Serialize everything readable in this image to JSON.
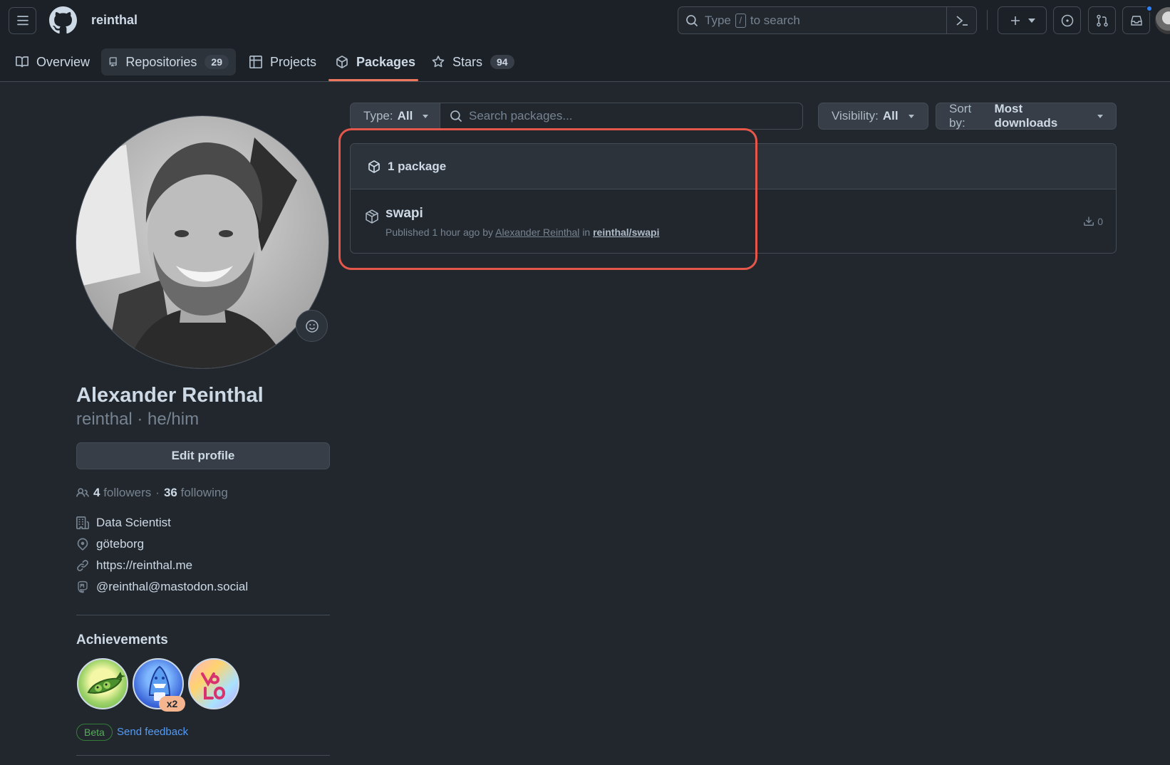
{
  "header": {
    "username": "reinthal",
    "search": {
      "pre": "Type",
      "key": "/",
      "post": "to search"
    }
  },
  "tabs": [
    {
      "label": "Overview"
    },
    {
      "label": "Repositories",
      "count": "29"
    },
    {
      "label": "Projects"
    },
    {
      "label": "Packages"
    },
    {
      "label": "Stars",
      "count": "94"
    }
  ],
  "profile": {
    "name": "Alexander Reinthal",
    "subname": "reinthal · he/him",
    "edit_label": "Edit profile",
    "followers_count": "4",
    "followers_label": "followers",
    "dot": "·",
    "following_count": "36",
    "following_label": "following",
    "company": "Data Scientist",
    "location": "göteborg",
    "website": "https://reinthal.me",
    "mastodon": "@reinthal@mastodon.social"
  },
  "achievements": {
    "title": "Achievements",
    "multiplier": "x2",
    "beta": "Beta",
    "feedback": "Send feedback"
  },
  "filters": {
    "type_label": "Type:",
    "type_value": "All",
    "search_placeholder": "Search packages...",
    "visibility_label": "Visibility:",
    "visibility_value": "All",
    "sort_label": "Sort by:",
    "sort_value": "Most downloads"
  },
  "packages": {
    "count_label": "1 package",
    "items": [
      {
        "name": "swapi",
        "published": "Published 1 hour ago by",
        "author": "Alexander Reinthal",
        "in": "in",
        "repo": "reinthal/swapi",
        "downloads": "0"
      }
    ]
  },
  "colors": {
    "accent_underline": "#ec775c",
    "highlight_box": "#e5574a",
    "link": "#539bf5",
    "notification": "#2f81f7"
  }
}
